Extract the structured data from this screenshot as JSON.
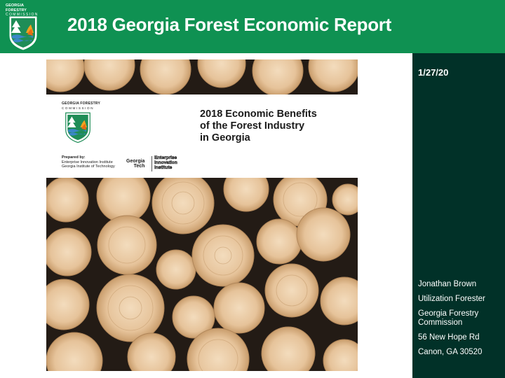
{
  "header": {
    "logo_line1": "GEORGIA FORESTRY",
    "logo_line2": "COMMISSION",
    "title": "2018 Georgia Forest Economic Report"
  },
  "sidebar": {
    "date": "1/27/20",
    "contact": [
      "Jonathan Brown",
      "Utilization Forester",
      "Georgia Forestry Commission",
      "56 New Hope Rd",
      "Canon, GA 30520"
    ]
  },
  "cover": {
    "logo_line1": "GEORGIA FORESTRY",
    "logo_line2": "COMMISSION",
    "heading_line1": "2018 Economic Benefits",
    "heading_line2": "of the Forest Industry",
    "heading_line3": "in Georgia",
    "prepared_label": "Prepared by:",
    "prepared_line1": "Enterprise Innovation Institute",
    "prepared_line2": "Georgia Institute of Technology",
    "gt_line1": "Georgia",
    "gt_line2": "Tech",
    "eii_line1": "Enterprise",
    "eii_line2": "Innovation",
    "eii_line3": "Institute"
  },
  "colors": {
    "header_green": "#0f9152",
    "sidebar_dark": "#013128",
    "log_wood": "#e6c39a",
    "log_background": "#231b15"
  }
}
